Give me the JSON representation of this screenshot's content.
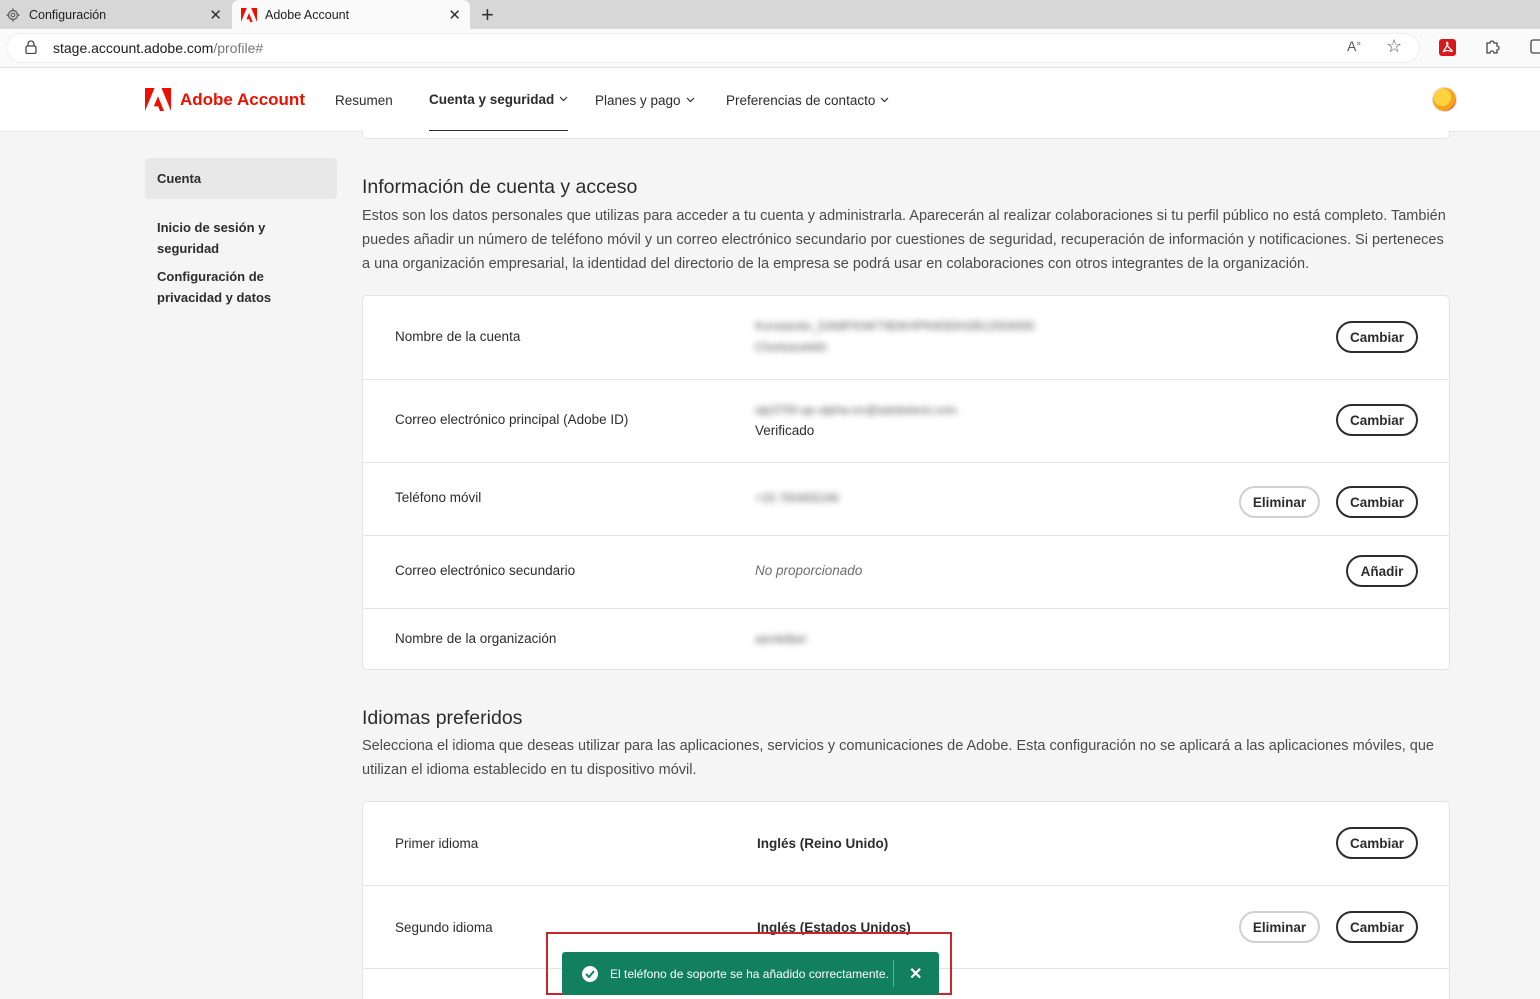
{
  "browser": {
    "tabs": [
      {
        "title": "Configuración",
        "icon": "gear-icon"
      },
      {
        "title": "Adobe Account",
        "icon": "adobe-logo-icon"
      }
    ],
    "url_host": "stage.account.adobe.com",
    "url_path": "/profile#"
  },
  "header": {
    "brand": "Adobe Account",
    "nav": [
      {
        "label": "Resumen"
      },
      {
        "label": "Cuenta y seguridad",
        "active": true
      },
      {
        "label": "Planes y pago"
      },
      {
        "label": "Preferencias de contacto"
      }
    ]
  },
  "sidebar": {
    "items": [
      {
        "label": "Cuenta",
        "selected": true
      },
      {
        "label": "Inicio de sesión y seguridad"
      },
      {
        "label": "Configuración de privacidad y datos"
      }
    ]
  },
  "account": {
    "title": "Información de cuenta y acceso",
    "description": "Estos son los datos personales que utilizas para acceder a tu cuenta y administrarla. Aparecerán al realizar colaboraciones si tu perfil público no está completo. También puedes añadir un número de teléfono móvil y un correo electrónico secundario por cuestiones de seguridad, recuperación de información y notificaciones. Si perteneces a una organización empresarial, la identidad del directorio de la empresa se podrá usar en colaboraciones con otros integrantes de la organización.",
    "rows": [
      {
        "label": "Nombre de la cuenta",
        "value_line1": "Konstantin_DAMFKNKT9DKHPKM3DH2B12004000",
        "value_line2": "Cherkasskikh",
        "change": "Cambiar"
      },
      {
        "label": "Correo electrónico principal (Adobe ID)",
        "value_line1": "alp3700-qe-alpha-en@adobetest.com",
        "value_line2": "Verificado",
        "change": "Cambiar"
      },
      {
        "label": "Teléfono móvil",
        "value_line1": "+33 783455246",
        "remove": "Eliminar",
        "change": "Cambiar"
      },
      {
        "label": "Correo electrónico secundario",
        "value_line1": "No proporcionado",
        "add": "Añadir"
      },
      {
        "label": "Nombre de la organización",
        "value_line1": "aemkilbel"
      }
    ]
  },
  "languages": {
    "title": "Idiomas preferidos",
    "description": "Selecciona el idioma que deseas utilizar para las aplicaciones, servicios y comunicaciones de Adobe. Esta configuración no se aplicará a las aplicaciones móviles, que utilizan el idioma establecido en tu dispositivo móvil.",
    "rows": [
      {
        "label": "Primer idioma",
        "value": "Inglés (Reino Unido)",
        "change": "Cambiar"
      },
      {
        "label": "Segundo idioma",
        "value": "Inglés (Estados Unidos)",
        "remove": "Eliminar",
        "change": "Cambiar"
      }
    ]
  },
  "toast": {
    "message": "El teléfono de soporte se ha añadido correctamente.",
    "color": "#12805c"
  },
  "colors": {
    "brand_red": "#eb1000",
    "highlight_outline": "#c9252c"
  }
}
